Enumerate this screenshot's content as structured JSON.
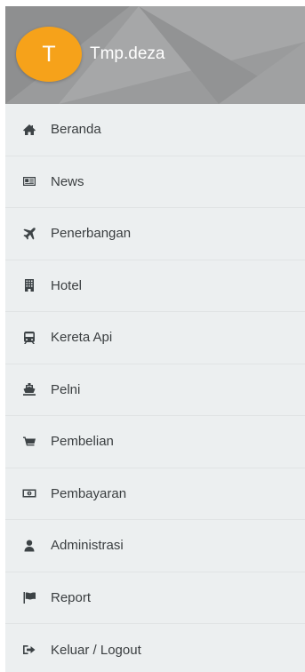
{
  "user": {
    "initial": "T",
    "name": "Tmp.deza"
  },
  "colors": {
    "header_bg": "#9a9b9c",
    "avatar_bg": "#f6a21a",
    "drawer_bg": "#eceff0",
    "text": "#3a3e40"
  },
  "menu": [
    {
      "label": "Beranda",
      "icon": "home-icon"
    },
    {
      "label": "News",
      "icon": "newspaper-icon"
    },
    {
      "label": "Penerbangan",
      "icon": "plane-icon"
    },
    {
      "label": "Hotel",
      "icon": "building-icon"
    },
    {
      "label": "Kereta Api",
      "icon": "train-icon"
    },
    {
      "label": "Pelni",
      "icon": "ship-icon"
    },
    {
      "label": "Pembelian",
      "icon": "cart-icon"
    },
    {
      "label": "Pembayaran",
      "icon": "money-icon"
    },
    {
      "label": "Administrasi",
      "icon": "user-icon"
    },
    {
      "label": "Report",
      "icon": "flag-icon"
    },
    {
      "label": "Keluar / Logout",
      "icon": "logout-icon"
    }
  ]
}
